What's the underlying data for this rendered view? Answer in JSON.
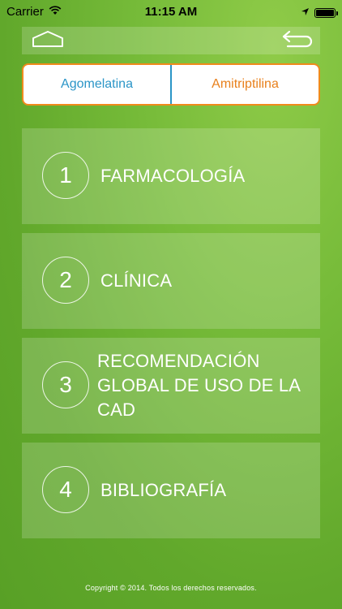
{
  "status_bar": {
    "carrier": "Carrier",
    "time": "11:15 AM",
    "icons": [
      "wifi-icon",
      "location-arrow-icon",
      "battery-icon"
    ]
  },
  "nav": {
    "home_icon": "home-outline-icon",
    "back_icon": "back-arrow-icon"
  },
  "segments": [
    {
      "label": "Agomelatina",
      "color": "#2b95c7",
      "selected": true
    },
    {
      "label": "Amitriptilina",
      "color": "#e8801c",
      "selected": false
    }
  ],
  "menu": [
    {
      "number": "1",
      "label": "FARMACOLOGÍA"
    },
    {
      "number": "2",
      "label": "CLÍNICA"
    },
    {
      "number": "3",
      "label": "RECOMENDACIÓN GLOBAL DE USO DE LA CAD"
    },
    {
      "number": "4",
      "label": "BIBLIOGRAFÍA"
    }
  ],
  "footer": {
    "copyright": "Copyright © 2014. Todos los derechos reservados."
  }
}
